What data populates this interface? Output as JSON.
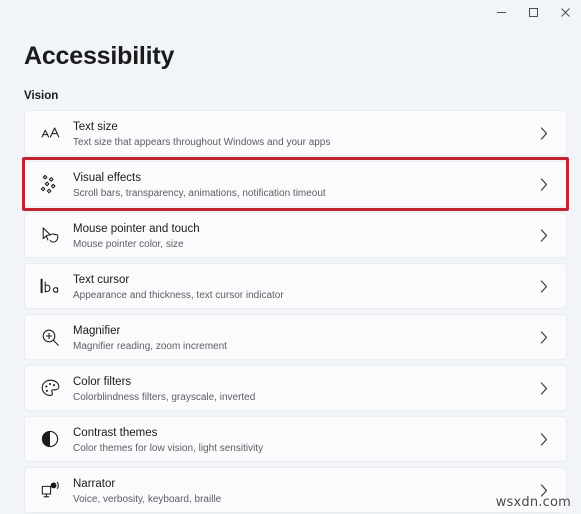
{
  "window": {
    "controls": [
      {
        "name": "minimize-button",
        "label": "–"
      },
      {
        "name": "maximize-button",
        "label": "□"
      },
      {
        "name": "close-button",
        "label": "✕"
      }
    ]
  },
  "page": {
    "title": "Accessibility",
    "section_label": "Vision"
  },
  "colors": {
    "background": "#f1f4f9",
    "card": "#fbfbfd",
    "highlight": "#c1262f",
    "title_text": "#1b1b1b",
    "sub_text": "#5d5d63"
  },
  "settings": [
    {
      "icon": "text-size-icon",
      "title": "Text size",
      "subtitle": "Text size that appears throughout Windows and your apps",
      "highlighted": false
    },
    {
      "icon": "visual-effects-sparkle-icon",
      "title": "Visual effects",
      "subtitle": "Scroll bars, transparency, animations, notification timeout",
      "highlighted": true
    },
    {
      "icon": "mouse-pointer-icon",
      "title": "Mouse pointer and touch",
      "subtitle": "Mouse pointer color, size",
      "highlighted": false
    },
    {
      "icon": "text-cursor-icon",
      "title": "Text cursor",
      "subtitle": "Appearance and thickness, text cursor indicator",
      "highlighted": false
    },
    {
      "icon": "magnifier-icon",
      "title": "Magnifier",
      "subtitle": "Magnifier reading, zoom increment",
      "highlighted": false
    },
    {
      "icon": "color-filters-palette-icon",
      "title": "Color filters",
      "subtitle": "Colorblindness filters, grayscale, inverted",
      "highlighted": false
    },
    {
      "icon": "contrast-themes-icon",
      "title": "Contrast themes",
      "subtitle": "Color themes for low vision, light sensitivity",
      "highlighted": false
    },
    {
      "icon": "narrator-icon",
      "title": "Narrator",
      "subtitle": "Voice, verbosity, keyboard, braille",
      "highlighted": false
    }
  ],
  "watermark": "wsxdn.com"
}
